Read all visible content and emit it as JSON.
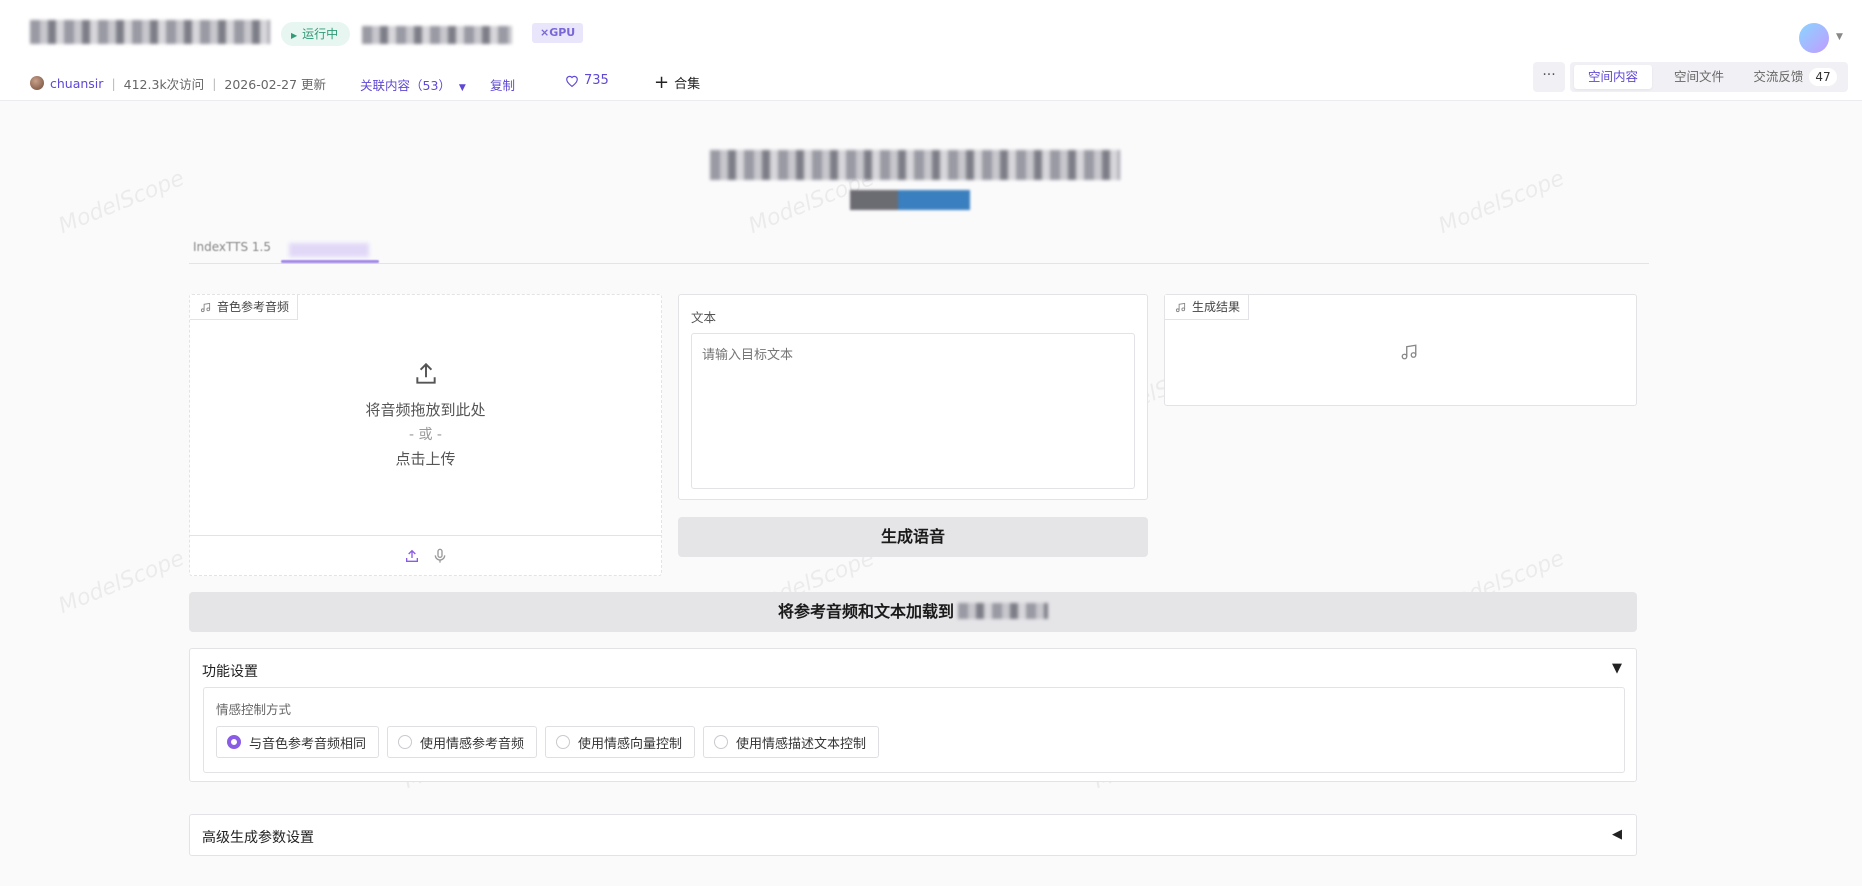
{
  "header": {
    "status": "运行中",
    "gpu_badge": "GPU",
    "author": "chuansir",
    "visits": "412.3k次访问",
    "updated": "2026-02-27 更新",
    "related": "关联内容（53）",
    "copy": "复制",
    "likes": "735",
    "collect": "合集",
    "more": "···",
    "tabs": [
      {
        "label": "空间内容",
        "active": true
      },
      {
        "label": "空间文件",
        "active": false
      },
      {
        "label": "交流反馈",
        "count": "47",
        "active": false
      }
    ]
  },
  "content": {
    "tab1_label": "IndexTTS 1.5",
    "watermark": "ModelScope"
  },
  "upload": {
    "label": "音色参考音频",
    "drop_text": "将音频拖放到此处",
    "or_text": "- 或 -",
    "click_text": "点击上传"
  },
  "text_input": {
    "label": "文本",
    "placeholder": "请输入目标文本"
  },
  "result": {
    "label": "生成结果"
  },
  "buttons": {
    "generate": "生成语音",
    "load": "将参考音频和文本加载到"
  },
  "settings": {
    "title": "功能设置",
    "arrow": "▼",
    "group_label": "情感控制方式",
    "options": [
      "与音色参考音频相同",
      "使用情感参考音频",
      "使用情感向量控制",
      "使用情感描述文本控制"
    ],
    "selected": 0
  },
  "advanced": {
    "title": "高级生成参数设置",
    "arrow": "◀"
  },
  "colors": {
    "accent": "#5f48d4",
    "radio_on": "#8a5ce6"
  }
}
